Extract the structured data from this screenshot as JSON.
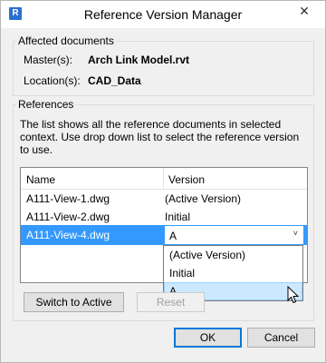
{
  "window": {
    "title": "Reference Version Manager",
    "app_icon": "R",
    "close_glyph": "✕"
  },
  "affected": {
    "legend": "Affected documents",
    "master_label": "Master(s):",
    "master_value": "Arch Link Model.rvt",
    "location_label": "Location(s):",
    "location_value": "CAD_Data"
  },
  "references": {
    "legend": "References",
    "description": "The list shows all the reference documents in selected context. Use drop down list to select the reference version to use.",
    "columns": [
      "Name",
      "Version"
    ],
    "rows": [
      {
        "name": "A111-View-1.dwg",
        "version": "(Active Version)"
      },
      {
        "name": "A111-View-2.dwg",
        "version": "Initial"
      },
      {
        "name": "A111-View-4.dwg",
        "version": "A"
      }
    ],
    "combo_arrow": "˅",
    "dropdown_options": [
      "(Active Version)",
      "Initial",
      "A"
    ],
    "switch_button": "Switch to Active",
    "reset_button": "Reset"
  },
  "footer": {
    "ok_button": "OK",
    "cancel_button": "Cancel"
  },
  "colors": {
    "selection": "#3399ff",
    "hover": "#cce8ff",
    "default_button_border": "#0078d7"
  }
}
